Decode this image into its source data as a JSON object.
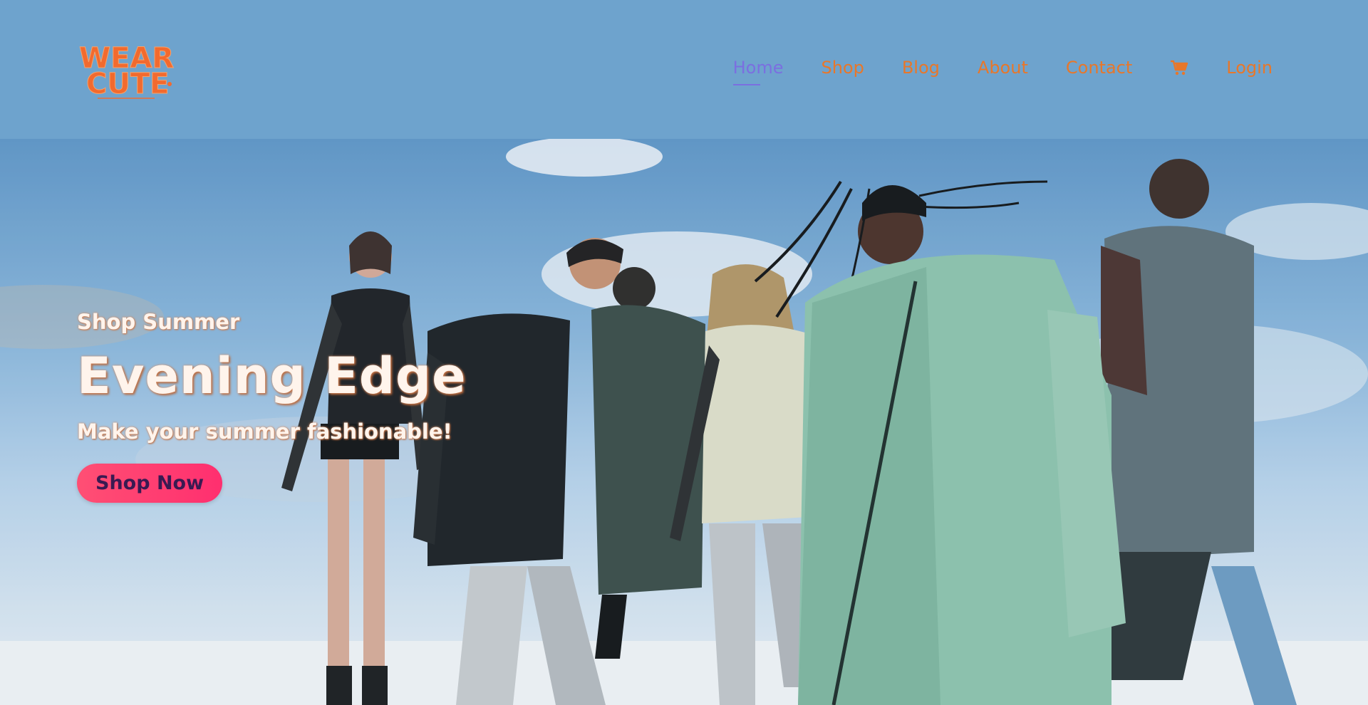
{
  "brand": {
    "logo_line1": "WEAR",
    "logo_line2": "CUTE",
    "logo_color": "#f26a2e"
  },
  "nav": {
    "items": [
      {
        "label": "Home",
        "active": true
      },
      {
        "label": "Shop",
        "active": false
      },
      {
        "label": "Blog",
        "active": false
      },
      {
        "label": "About",
        "active": false
      },
      {
        "label": "Contact",
        "active": false
      }
    ],
    "cart_icon": "shopping-cart-icon",
    "login_label": "Login",
    "link_color": "#e8772a",
    "active_color": "#7b6fe0"
  },
  "hero": {
    "eyebrow": "Shop Summer",
    "headline": "Evening Edge",
    "tagline": "Make your summer fashionable!",
    "cta_label": "Shop Now",
    "cta_color": "#ff3d72"
  }
}
